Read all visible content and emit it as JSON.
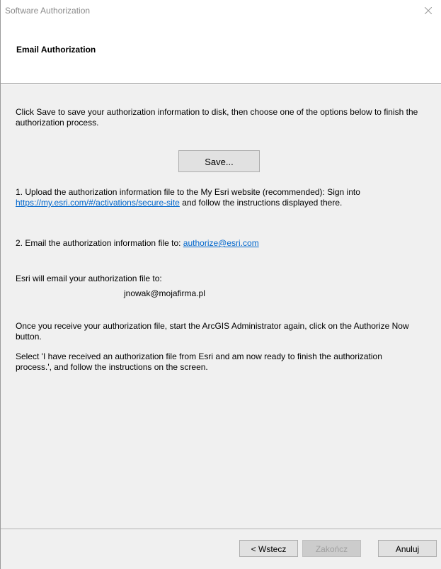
{
  "window": {
    "title": "Software Authorization"
  },
  "header": {
    "title": "Email Authorization"
  },
  "content": {
    "intro": "Click Save to save your authorization information to disk, then choose one of the options below to finish the authorization process.",
    "save_label": "Save...",
    "option1_prefix": "1.  Upload the authorization information file to the My Esri website (recommended): Sign into ",
    "option1_link": "https://my.esri.com/#/activations/secure-site",
    "option1_suffix": " and follow the instructions displayed there.",
    "option2_prefix": "2.  Email the authorization information file to: ",
    "option2_link": "authorize@esri.com",
    "esri_email_label": "Esri will email your authorization file to:",
    "user_email": "jnowak@mojafirma.pl",
    "once_text": "Once you receive your authorization file, start the ArcGIS Administrator again, click on the Authorize Now button.",
    "select_text": "Select 'I have received an authorization file from Esri and am now ready to finish the authorization process.', and follow the instructions on the screen."
  },
  "footer": {
    "back_label": "< Wstecz",
    "finish_label": "Zakończ",
    "cancel_label": "Anuluj"
  },
  "colors": {
    "link": "#0066cc",
    "panel_bg": "#f0f0f0",
    "disabled_text": "#a0a0a0"
  },
  "icons": {
    "close": "close-icon"
  }
}
